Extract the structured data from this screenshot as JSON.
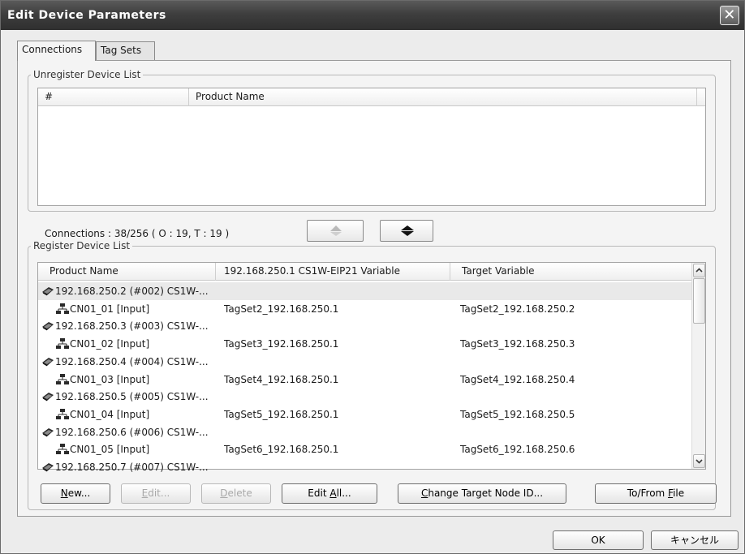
{
  "window": {
    "title": "Edit Device Parameters",
    "close_glyph": "✕"
  },
  "tabs": [
    {
      "label": "Connections",
      "active": true
    },
    {
      "label": "Tag Sets",
      "active": false
    }
  ],
  "unregister": {
    "group_label": "Unregister Device List",
    "columns": [
      "#",
      "Product Name"
    ]
  },
  "connections_info": "Connections :  38/256 ( O : 19, T : 19 )",
  "move_up_icon": "arrow-up-icon",
  "move_down_icon": "arrow-down-icon",
  "register": {
    "group_label": "Register Device List",
    "columns": [
      "Product Name",
      "192.168.250.1 CS1W-EIP21 Variable",
      "Target Variable"
    ],
    "rows": [
      {
        "type": "device",
        "name": "192.168.250.2 (#002) CS1W-...",
        "var": "",
        "target": "",
        "selected": true
      },
      {
        "type": "conn",
        "name": "CN01_01 [Input]",
        "var": "TagSet2_192.168.250.1",
        "target": "TagSet2_192.168.250.2"
      },
      {
        "type": "device",
        "name": "192.168.250.3 (#003) CS1W-...",
        "var": "",
        "target": ""
      },
      {
        "type": "conn",
        "name": "CN01_02 [Input]",
        "var": "TagSet3_192.168.250.1",
        "target": "TagSet3_192.168.250.3"
      },
      {
        "type": "device",
        "name": "192.168.250.4 (#004) CS1W-...",
        "var": "",
        "target": ""
      },
      {
        "type": "conn",
        "name": "CN01_03 [Input]",
        "var": "TagSet4_192.168.250.1",
        "target": "TagSet4_192.168.250.4"
      },
      {
        "type": "device",
        "name": "192.168.250.5 (#005) CS1W-...",
        "var": "",
        "target": ""
      },
      {
        "type": "conn",
        "name": "CN01_04 [Input]",
        "var": "TagSet5_192.168.250.1",
        "target": "TagSet5_192.168.250.5"
      },
      {
        "type": "device",
        "name": "192.168.250.6 (#006) CS1W-...",
        "var": "",
        "target": ""
      },
      {
        "type": "conn",
        "name": "CN01_05 [Input]",
        "var": "TagSet6_192.168.250.1",
        "target": "TagSet6_192.168.250.6"
      },
      {
        "type": "device",
        "name": "192.168.250.7 (#007) CS1W-...",
        "var": "",
        "target": ""
      }
    ]
  },
  "buttons": {
    "new": {
      "mn": "N",
      "rest": "ew..."
    },
    "edit": {
      "mn": "E",
      "rest": "dit..."
    },
    "delete": {
      "mn": "D",
      "rest": "elete"
    },
    "edit_all": {
      "pre": "Edit ",
      "mn": "A",
      "rest": "ll..."
    },
    "change_target": {
      "mn": "C",
      "rest": "hange Target Node ID..."
    },
    "to_from_file": {
      "pre": "To/From ",
      "mn": "F",
      "rest": "ile"
    },
    "ok": "OK",
    "cancel": "キャンセル"
  }
}
